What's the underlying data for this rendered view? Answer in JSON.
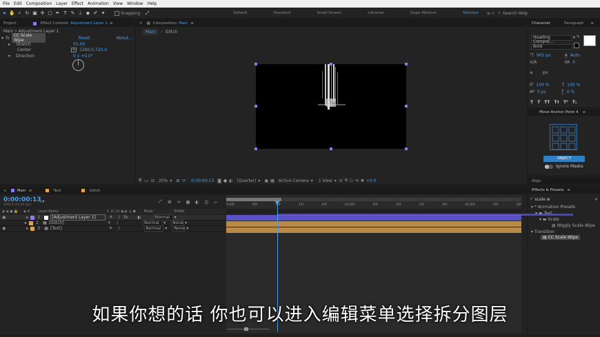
{
  "menu": [
    "File",
    "Edit",
    "Composition",
    "Layer",
    "Effect",
    "Animation",
    "View",
    "Window",
    "Help"
  ],
  "toolbar": {
    "snapping": "Snapping",
    "workspaces": [
      "Default",
      "Standard",
      "Small Screen",
      "Libraries",
      "Dope Motions",
      "Tutorials"
    ],
    "search_placeholder": "Search Help"
  },
  "project_panel": {
    "tab_project": "Project",
    "tab_effect_controls": "Effect Controls",
    "effect_controls_target": "Adjustment Layer 1",
    "breadcrumb": "Main • Adjustment Layer 1",
    "effect_name": "CC Scale Wipe",
    "reset": "Reset",
    "about": "About...",
    "props": [
      {
        "label": "Stretch",
        "value": "55.00"
      },
      {
        "label": "Center",
        "value": "1280.0,720.0"
      },
      {
        "label": "Direction",
        "value": "0 x +0.0°"
      }
    ]
  },
  "composition": {
    "tab_label": "Composition",
    "tab_name": "Main",
    "subtabs": [
      "Main",
      "Glitch"
    ],
    "zoom": "25%",
    "timecode": "0:00:00:13",
    "resolution": "(Quarter)",
    "camera": "Active Camera",
    "view": "1 View",
    "exposure": "+0.0"
  },
  "character": {
    "tab_character": "Character",
    "tab_paragraph": "Paragraph",
    "font": "Heading Compre...",
    "style": "Bold",
    "size": "965 px",
    "leading": "Auto",
    "tracking": "0",
    "unit": "px",
    "vscale": "100 %",
    "hscale": "100 %",
    "baseline": "0 px",
    "tsume": "0 %"
  },
  "anchor": {
    "title": "Move Anchor Point 4",
    "object_btn": "OBJECT",
    "ignore_masks": "Ignore Masks"
  },
  "align": {
    "title": "Align"
  },
  "effects_presets": {
    "title": "Effects & Presets",
    "search": "scale w",
    "tree": [
      {
        "label": "* Animation Presets",
        "indent": 0
      },
      {
        "label": "Text",
        "indent": 1
      },
      {
        "label": "Scale",
        "indent": 2
      },
      {
        "label": "Wiggly Scale Wipe",
        "indent": 3
      },
      {
        "label": "Transition",
        "indent": 0
      },
      {
        "label": "CC Scale Wipe",
        "indent": 1
      }
    ]
  },
  "timeline": {
    "tabs": [
      "Main",
      "Text",
      "Glitch"
    ],
    "timecode": "0:00:00:13",
    "fps_info": "00013 (24.00 fps)",
    "columns": {
      "layer_name": "Layer Name",
      "mode": "Mode",
      "trkmat": "TrkMat",
      "parent": "Parent"
    },
    "layers": [
      {
        "num": "1",
        "name": "[Adjustment Layer 1]",
        "mode": "Normal",
        "trkmat": "",
        "parent": "None",
        "color": "#8b7cf0"
      },
      {
        "num": "2",
        "name": "[Glitch]",
        "mode": "Normal",
        "trkmat": "None",
        "parent": "None",
        "color": "#e0a44a"
      },
      {
        "num": "3",
        "name": "[Text]",
        "mode": "Normal",
        "trkmat": "None",
        "parent": "None",
        "color": "#e0a44a"
      }
    ],
    "ruler": [
      "0:00f",
      "05f",
      "10f",
      "15f",
      "20f",
      "01:00f",
      "05f",
      "10f",
      "15f",
      "20f",
      "02:00f",
      "05f",
      "10f"
    ]
  },
  "subtitle": "如果你想的话 你也可以进入编辑菜单选择拆分图层",
  "colors": {
    "accent": "#4c9eea",
    "layer_adjustment": "#6a5fe0",
    "layer_precomp": "#c9964a"
  }
}
